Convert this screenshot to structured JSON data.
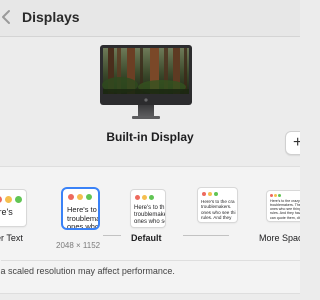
{
  "window": {
    "title": "Displays"
  },
  "display": {
    "name": "Built-in Display",
    "add_button_label": "+"
  },
  "resolution_options": [
    {
      "label": "ger Text",
      "sample_text": "Here's",
      "resolution": "",
      "selected": false
    },
    {
      "label": "",
      "sample_text": "Here's to\ntroublema\nones who",
      "resolution": "2048 × 1152",
      "selected": true
    },
    {
      "label": "Default",
      "sample_text": "Here's to th\ntroublemake\nones who se",
      "resolution": "",
      "selected": false
    },
    {
      "label": "",
      "sample_text": "Here's to the cra\ntroublemakers.\nones who see thi\nrules. And they",
      "resolution": "",
      "selected": false
    },
    {
      "label": "More Spac",
      "sample_text": "Here's to the crazy one\ntroublemakers. The rou\nones who see things d\nrules. And they have n\ncan quote them, disagr",
      "resolution": "",
      "selected": false
    }
  ],
  "footnote": "g a scaled resolution may affect performance.",
  "colors": {
    "traffic_red": "#ed6a5e",
    "traffic_yellow": "#f5bf4f",
    "traffic_green": "#61c554",
    "selection_blue": "#3a82f7"
  }
}
